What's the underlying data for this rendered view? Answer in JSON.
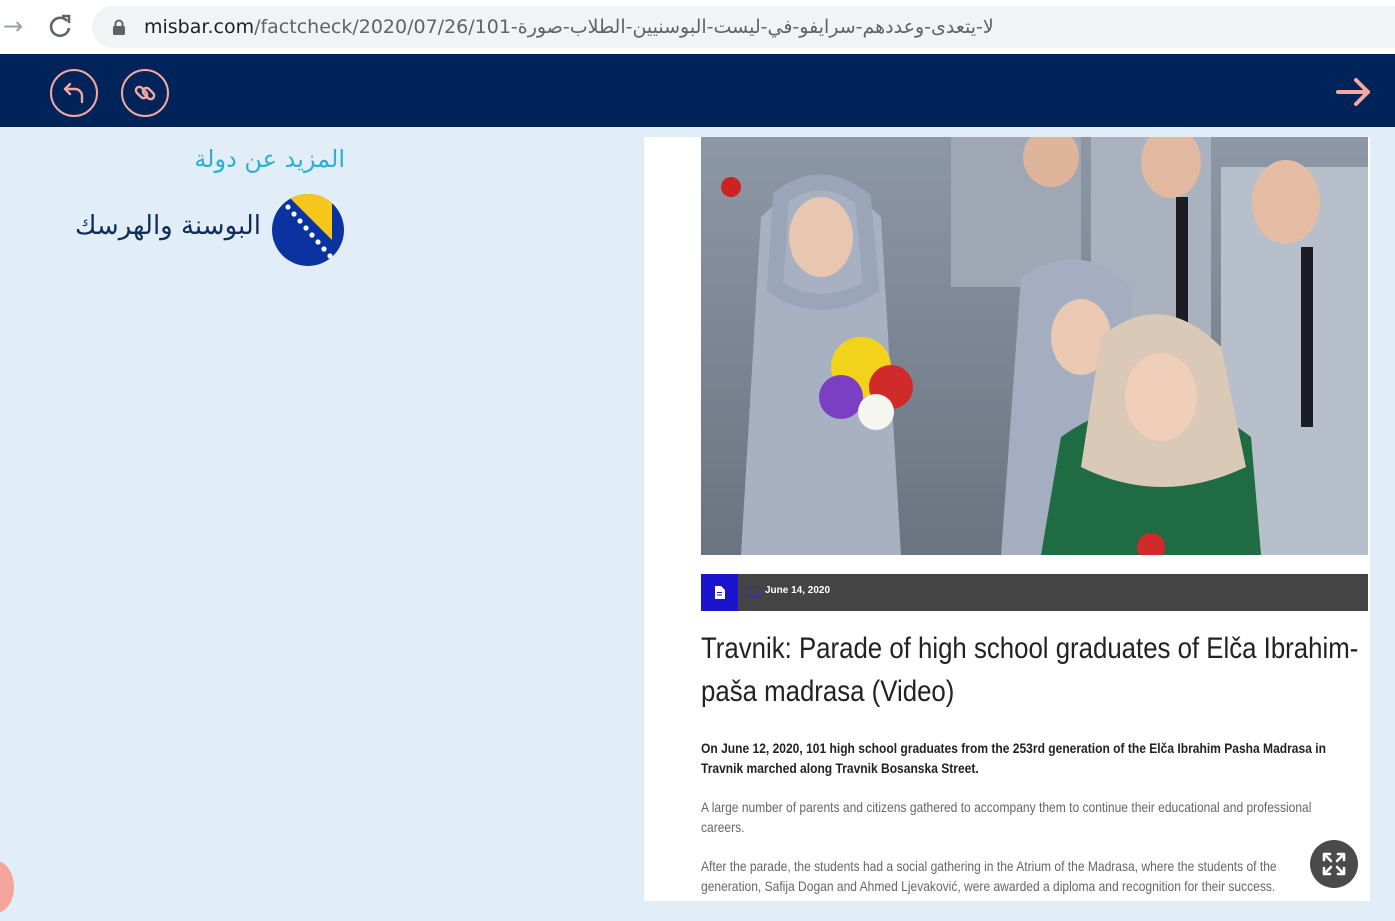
{
  "browser": {
    "url_host": "misbar.com",
    "url_path": "/factcheck/2020/07/26/101-لا-يتعدى-وعددهم-سرايفو-في-ليست-البوسنيين-الطلاب-صورة",
    "back_icon": "arrow-left-icon",
    "reload_icon": "reload-icon",
    "lock_icon": "lock-icon"
  },
  "header": {
    "background": "#00235a",
    "accent": "#f4a8a0",
    "back_button_icon": "circle-arrow-back-icon",
    "copy_link_icon": "link-icon",
    "next_icon": "arrow-right-icon"
  },
  "sidebar": {
    "title": "المزيد عن دولة",
    "country_name": "البوسنة والهرسك",
    "flag_icon": "bosnia-flag-icon"
  },
  "article": {
    "date": "June 14, 2020",
    "title": "Travnik: Parade of high school graduates of Elča Ibrahim-paša madrasa (Video)",
    "lead": "On June 12, 2020, 101 high school graduates from the 253rd generation of the Elča Ibrahim Pasha Madrasa in Travnik marched along Travnik Bosanska Street.",
    "paragraph_1": "A large number of parents and citizens gathered to accompany them to continue their educational and professional careers.",
    "paragraph_2": "After the parade, the students had a social gathering in the Atrium of the Madrasa, where the students of the generation, Safija Dogan and Ahmed Ljevaković, were awarded a diploma and recognition for their success.",
    "doc_icon": "document-icon",
    "calendar_icon": "calendar-icon",
    "expand_icon": "expand-icon"
  }
}
